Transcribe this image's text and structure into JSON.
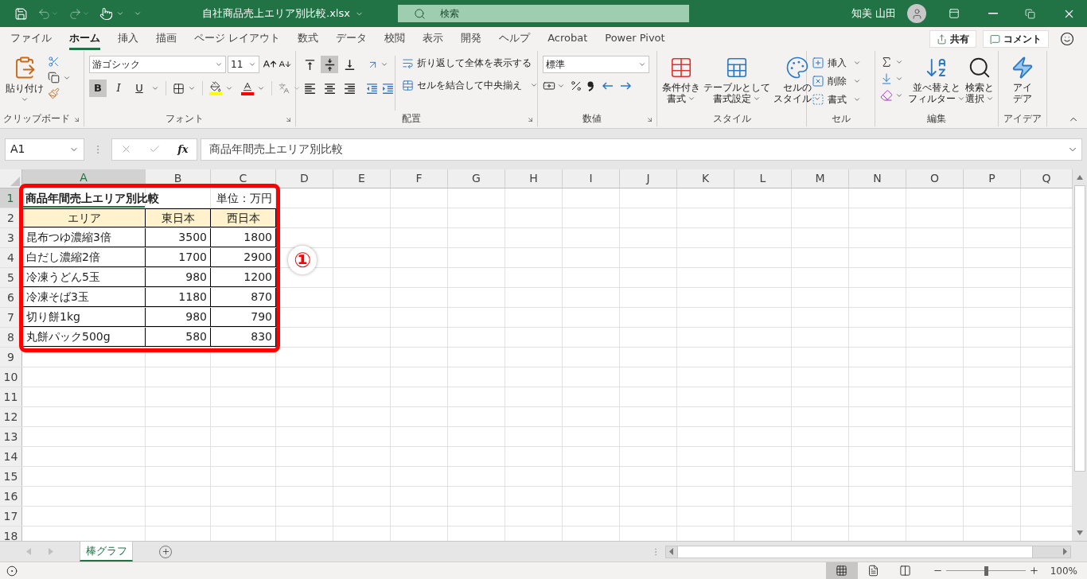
{
  "title_bar": {
    "file_name": "自社商品売上エリア別比較.xlsx",
    "search_placeholder": "検索",
    "user_name": "知美 山田"
  },
  "menu_tabs": [
    {
      "label": "ファイル",
      "selected": false
    },
    {
      "label": "ホーム",
      "selected": true
    },
    {
      "label": "挿入",
      "selected": false
    },
    {
      "label": "描画",
      "selected": false
    },
    {
      "label": "ページ レイアウト",
      "selected": false
    },
    {
      "label": "数式",
      "selected": false
    },
    {
      "label": "データ",
      "selected": false
    },
    {
      "label": "校閲",
      "selected": false
    },
    {
      "label": "表示",
      "selected": false
    },
    {
      "label": "開発",
      "selected": false
    },
    {
      "label": "ヘルプ",
      "selected": false
    },
    {
      "label": "Acrobat",
      "selected": false
    },
    {
      "label": "Power Pivot",
      "selected": false
    }
  ],
  "share_button": "共有",
  "comment_button": "コメント",
  "ribbon": {
    "clipboard": {
      "label": "クリップボード",
      "paste": "貼り付け"
    },
    "font": {
      "label": "フォント",
      "font_name": "游ゴシック",
      "font_size": "11",
      "styles": [
        {
          "label": "B",
          "selected": true
        },
        {
          "label": "I",
          "selected": false
        },
        {
          "label": "U",
          "selected": false
        }
      ]
    },
    "alignment": {
      "label": "配置",
      "vertical": [
        {
          "kind": "top",
          "selected": false
        },
        {
          "kind": "middle",
          "selected": true
        },
        {
          "kind": "bottom",
          "selected": false
        }
      ],
      "horizontal": [
        {
          "kind": "left",
          "selected": false
        },
        {
          "kind": "center",
          "selected": false
        },
        {
          "kind": "right",
          "selected": false
        }
      ],
      "wrap_text": "折り返して全体を表示する",
      "merge_center": "セルを結合して中央揃え"
    },
    "number": {
      "label": "数値",
      "format": "標準"
    },
    "styles": {
      "label": "スタイル",
      "buttons": [
        {
          "lines": [
            "条件付き",
            "書式"
          ]
        },
        {
          "lines": [
            "テーブルとして",
            "書式設定"
          ]
        },
        {
          "lines": [
            "セルの",
            "スタイル"
          ]
        }
      ]
    },
    "cells": {
      "label": "セル",
      "buttons": [
        "挿入",
        "削除",
        "書式"
      ]
    },
    "editing": {
      "label": "編集",
      "buttons": [
        {
          "lines": [
            "並べ替えと",
            "フィルター"
          ]
        },
        {
          "lines": [
            "検索と",
            "選択"
          ]
        }
      ]
    },
    "ideas": {
      "label": "アイデア",
      "lines": [
        "アイ",
        "デア"
      ]
    }
  },
  "formula_bar": {
    "name_box": "A1",
    "function_label": "fx",
    "formula": "商品年間売上エリア別比較"
  },
  "sheet": {
    "columns": [
      {
        "label": "A",
        "selected": true
      },
      {
        "label": "B",
        "selected": false
      },
      {
        "label": "C",
        "selected": false
      },
      {
        "label": "D",
        "selected": false
      },
      {
        "label": "E",
        "selected": false
      },
      {
        "label": "F",
        "selected": false
      },
      {
        "label": "G",
        "selected": false
      },
      {
        "label": "H",
        "selected": false
      },
      {
        "label": "I",
        "selected": false
      },
      {
        "label": "J",
        "selected": false
      },
      {
        "label": "K",
        "selected": false
      },
      {
        "label": "L",
        "selected": false
      },
      {
        "label": "M",
        "selected": false
      },
      {
        "label": "N",
        "selected": false
      },
      {
        "label": "O",
        "selected": false
      },
      {
        "label": "P",
        "selected": false
      },
      {
        "label": "Q",
        "selected": false
      }
    ],
    "row_numbers": [
      {
        "label": "1",
        "selected": true
      },
      {
        "label": "2",
        "selected": false
      },
      {
        "label": "3",
        "selected": false
      },
      {
        "label": "4",
        "selected": false
      },
      {
        "label": "5",
        "selected": false
      },
      {
        "label": "6",
        "selected": false
      },
      {
        "label": "7",
        "selected": false
      },
      {
        "label": "8",
        "selected": false
      },
      {
        "label": "9",
        "selected": false
      },
      {
        "label": "10",
        "selected": false
      },
      {
        "label": "11",
        "selected": false
      },
      {
        "label": "12",
        "selected": false
      },
      {
        "label": "13",
        "selected": false
      },
      {
        "label": "14",
        "selected": false
      },
      {
        "label": "15",
        "selected": false
      },
      {
        "label": "16",
        "selected": false
      },
      {
        "label": "17",
        "selected": false
      },
      {
        "label": "18",
        "selected": false
      }
    ],
    "title": "商品年間売上エリア別比較",
    "unit": "単位：万円",
    "header": [
      "エリア",
      "東日本",
      "西日本"
    ],
    "rows": [
      [
        "昆布つゆ濃縮3倍",
        "3500",
        "1800"
      ],
      [
        "白だし濃縮2倍",
        "1700",
        "2900"
      ],
      [
        "冷凍うどん5玉",
        "980",
        "1200"
      ],
      [
        "冷凍そば3玉",
        "1180",
        "870"
      ],
      [
        "切り餅1kg",
        "980",
        "790"
      ],
      [
        "丸餅パック500g",
        "580",
        "830"
      ]
    ]
  },
  "annotation": {
    "marker": "①"
  },
  "sheet_tabs": [
    {
      "label": "棒グラフ",
      "selected": true
    }
  ],
  "status_bar": {
    "views": [
      {
        "kind": "normal",
        "selected": true
      },
      {
        "kind": "page_layout",
        "selected": false
      },
      {
        "kind": "page_break",
        "selected": false
      }
    ],
    "zoom": {
      "level": 0.5
    },
    "zoom_text": "100%"
  }
}
